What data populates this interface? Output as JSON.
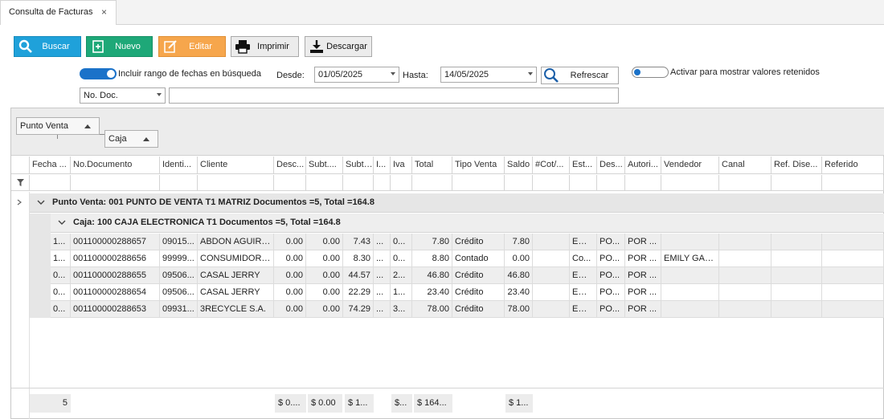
{
  "tab": {
    "title": "Consulta de Facturas",
    "close": "×"
  },
  "toolbar": {
    "buscar": "Buscar",
    "nuevo": "Nuevo",
    "editar": "Editar",
    "imprimir": "Imprimir",
    "descargar": "Descargar"
  },
  "filters": {
    "date_range_label": "Incluir rango de fechas en búsqueda",
    "desde_label": "Desde:",
    "desde_value": "01/05/2025",
    "hasta_label": "Hasta:",
    "hasta_value": "14/05/2025",
    "refrescar": "Refrescar",
    "retenidos_label": "Activar para mostrar valores retenidos",
    "search_field": "No. Doc.",
    "search_value": ""
  },
  "grouping": {
    "chip1": "Punto Venta",
    "chip2": "Caja"
  },
  "columns": [
    "Fecha ...",
    "No.Documento",
    "Identi...",
    "Cliente",
    "Desc...",
    "Subt....",
    "Subt....",
    "I...",
    "Iva",
    "Total",
    "Tipo Venta",
    "Saldo",
    "#Cot/...",
    "Est...",
    "Des...",
    "Autori...",
    "Vendedor",
    "Canal",
    "Ref. Dise...",
    "Referido"
  ],
  "groups": {
    "level1": "Punto Venta: 001 PUNTO DE VENTA T1 MATRIZ Documentos =5, Total =164.8",
    "level2": "Caja: 100 CAJA ELECTRONICA T1 Documentos =5, Total =164.8"
  },
  "rows": [
    [
      "1...",
      "001100000288657",
      "09015...",
      "ABDON AGUIRR...",
      "0.00",
      "0.00",
      "7.43",
      "...",
      "0...",
      "7.80",
      "Crédito",
      "7.80",
      "",
      "Emi...",
      "PO...",
      "POR ...",
      "",
      "",
      "",
      ""
    ],
    [
      "1...",
      "001100000288656",
      "99999...",
      "CONSUMIDOR F...",
      "0.00",
      "0.00",
      "8.30",
      "...",
      "0...",
      "8.80",
      "Contado",
      "0.00",
      "",
      "Co...",
      "PO...",
      "POR ...",
      "EMILY GAB...",
      "",
      "",
      ""
    ],
    [
      "0...",
      "001100000288655",
      "09506...",
      "CASAL JERRY",
      "0.00",
      "0.00",
      "44.57",
      "...",
      "2...",
      "46.80",
      "Crédito",
      "46.80",
      "",
      "Emi...",
      "PO...",
      "POR ...",
      "",
      "",
      "",
      ""
    ],
    [
      "0...",
      "001100000288654",
      "09506...",
      "CASAL JERRY",
      "0.00",
      "0.00",
      "22.29",
      "...",
      "1...",
      "23.40",
      "Crédito",
      "23.40",
      "",
      "Emi...",
      "PO...",
      "POR ...",
      "",
      "",
      "",
      ""
    ],
    [
      "0...",
      "001100000288653",
      "09931...",
      "3RECYCLE S.A.",
      "0.00",
      "0.00",
      "74.29",
      "...",
      "3...",
      "78.00",
      "Crédito",
      "78.00",
      "",
      "Emi...",
      "PO...",
      "POR ...",
      "",
      "",
      "",
      ""
    ]
  ],
  "footer": {
    "count": "5",
    "desc": "$ 0....",
    "subt1": "$ 0.00",
    "subt2": "$ 1...",
    "iva": "$...",
    "total": "$ 164...",
    "saldo": "$ 1..."
  },
  "colors": {
    "buscar": "#1fa1da",
    "nuevo": "#1ea878",
    "editar": "#f6a64c",
    "toggle": "#1b72c9"
  }
}
